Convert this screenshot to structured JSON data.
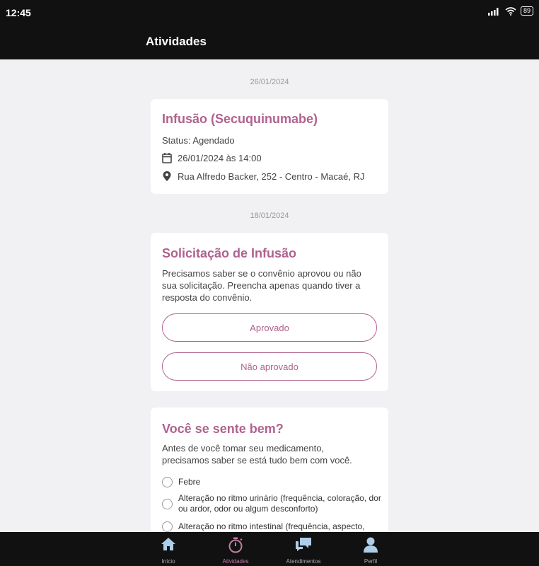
{
  "status_bar": {
    "time": "12:45",
    "battery": "89"
  },
  "app_bar": {
    "title": "Atividades"
  },
  "colors": {
    "accent": "#b0628f",
    "background": "#f1f1f3",
    "bars": "#111111"
  },
  "sections": [
    {
      "date": "26/01/2024",
      "card": {
        "title": "Infusão (Secuquinumabe)",
        "status": "Status: Agendado",
        "datetime": "26/01/2024 às 14:00",
        "address": "Rua Alfredo Backer, 252 - Centro - Macaé, RJ"
      }
    },
    {
      "date": "18/01/2024",
      "card": {
        "title": "Solicitação de Infusão",
        "lines": [
          "Precisamos saber se o convênio aprovou ou não",
          "sua solicitação. Preencha apenas quando tiver a",
          "resposta do convênio."
        ],
        "approve_label": "Aprovado",
        "reject_label": "Não aprovado"
      }
    }
  ],
  "wellness_card": {
    "title": "Você se sente bem?",
    "lines": [
      "Antes de você tomar seu medicamento,",
      "precisamos saber se está tudo bem com você."
    ],
    "options": [
      [
        "Febre"
      ],
      [
        "Alteração no ritmo urinário (frequência, coloração, dor",
        "ou ardor, odor ou algum desconforto)"
      ],
      [
        "Alteração no ritmo intestinal (frequência, aspecto,"
      ]
    ]
  },
  "bottom_nav": [
    {
      "label": "Início",
      "icon": "home-icon"
    },
    {
      "label": "Atividades",
      "icon": "stopwatch-icon",
      "active": true
    },
    {
      "label": "Atendimentos",
      "icon": "chat-icon"
    },
    {
      "label": "Perfil",
      "icon": "person-icon"
    }
  ]
}
